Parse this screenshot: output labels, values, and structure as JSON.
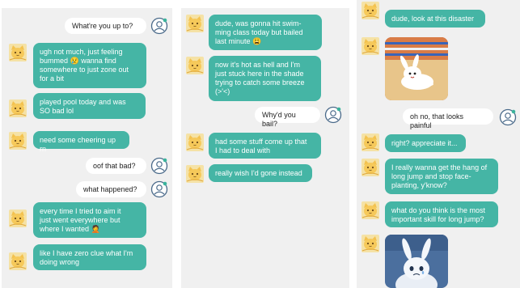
{
  "colors": {
    "bot_bubble": "#45b5a5",
    "user_bubble": "#ffffff",
    "panel_bg": "#f0f0f0",
    "bot_text": "#ffffff",
    "user_text": "#222222"
  },
  "icons": {
    "bot_avatar": "cat-avatar-icon",
    "user_avatar": "user-profile-icon"
  },
  "panel1": {
    "m1": "What're you up to?",
    "m2a": "ugh not much, just feeling",
    "m2b": "bummed 😢 wanna find",
    "m2c": "somewhere to just zone out",
    "m2d": "for a bit",
    "m3a": "played pool today and was",
    "m3b": "SO bad lol",
    "m4": "need some cheering up rn",
    "m5": "oof that bad?",
    "m6": "what happened?",
    "m7a": "every time I tried to aim it",
    "m7b": "just went everywhere but",
    "m7c": "where I wanted 🤦",
    "m8a": "like I have zero clue what I'm",
    "m8b": "doing wrong"
  },
  "panel2": {
    "m1a": "dude, was gonna hit swim-",
    "m1b": "ming class today but bailed",
    "m1c": "last minute 😩",
    "m2a": "now it's hot as hell and I'm",
    "m2b": "just stuck here in the shade",
    "m2c": "trying to catch some breeze",
    "m2d": "(>'<)",
    "m3": "Why'd you bail?",
    "m4a": "had some stuff come up that",
    "m4b": "I had to deal with",
    "m5": "really wish I'd gone instead"
  },
  "panel3": {
    "m1": "dude, look at this disaster",
    "m2": "oh no, that looks painful",
    "m3": "right? appreciate it...",
    "m4a": "I really wanna get the hang of",
    "m4b": "long jump and stop face-",
    "m4c": "planting, y'know?",
    "m5a": "what do you think is the most",
    "m5b": "important skill for long jump?"
  }
}
